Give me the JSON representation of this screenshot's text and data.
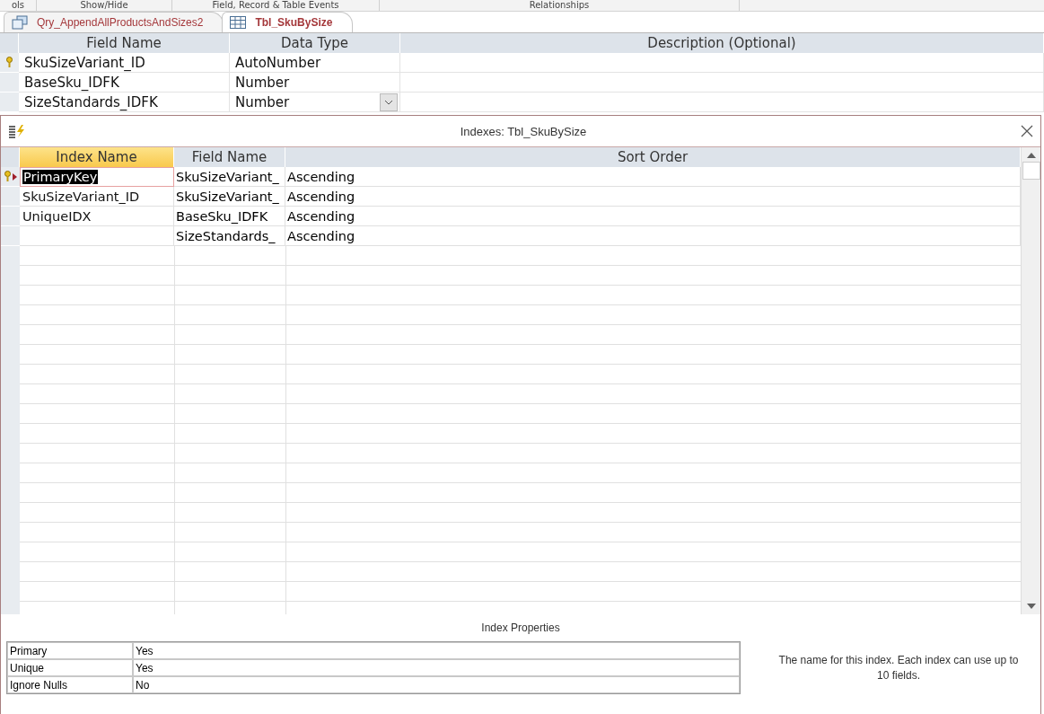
{
  "ribbon_groups": [
    "ols",
    "Show/Hide",
    "Field, Record & Table Events",
    "Relationships"
  ],
  "document_tabs": [
    {
      "label": "Qry_AppendAllProductsAndSizes2",
      "kind": "query",
      "selected": false
    },
    {
      "label": "Tbl_SkuBySize",
      "kind": "table",
      "selected": true
    }
  ],
  "design_grid": {
    "columns": [
      "Field Name",
      "Data Type",
      "Description (Optional)"
    ],
    "rows": [
      {
        "field_name": "SkuSizeVariant_ID",
        "data_type": "AutoNumber",
        "primary_key": true,
        "dropdown": false
      },
      {
        "field_name": "BaseSku_IDFK",
        "data_type": "Number",
        "primary_key": false,
        "dropdown": false
      },
      {
        "field_name": "SizeStandards_IDFK",
        "data_type": "Number",
        "primary_key": false,
        "dropdown": true
      }
    ]
  },
  "indexes_dialog": {
    "title": "Indexes: Tbl_SkuBySize",
    "columns": [
      "Index Name",
      "Field Name",
      "Sort Order"
    ],
    "rows": [
      {
        "index_name": "PrimaryKey",
        "field_name": "SkuSizeVariant_",
        "sort_order": "Ascending",
        "primary_key": true,
        "selected": true
      },
      {
        "index_name": "SkuSizeVariant_ID",
        "field_name": "SkuSizeVariant_",
        "sort_order": "Ascending",
        "primary_key": false,
        "selected": false
      },
      {
        "index_name": "UniqueIDX",
        "field_name": "BaseSku_IDFK",
        "sort_order": "Ascending",
        "primary_key": false,
        "selected": false
      },
      {
        "field_name": "SizeStandards_",
        "sort_order": "Ascending",
        "primary_key": false,
        "selected": false
      }
    ],
    "properties_title": "Index Properties",
    "properties": [
      {
        "label": "Primary",
        "value": "Yes"
      },
      {
        "label": "Unique",
        "value": "Yes"
      },
      {
        "label": "Ignore Nulls",
        "value": "No"
      }
    ],
    "help_text": "The name for this index.  Each index can use up to 10 fields."
  }
}
